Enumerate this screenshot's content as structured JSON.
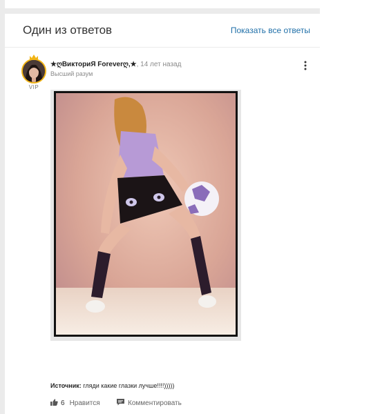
{
  "answer_card": {
    "title": "Один из ответов",
    "show_all_label": "Показать все ответы"
  },
  "author": {
    "name": "★ღВикториЯ Foreverღ,★",
    "time": "14 лет назад",
    "rank": "Высший разум",
    "badge": "VIP",
    "badge_color": "#f1b416"
  },
  "answer": {
    "source_label": "Источник:",
    "source_text": "гляди какие глазки лучше!!!!)))))"
  },
  "actions": {
    "likes_count": "6",
    "like_label": "Нравится",
    "comment_label": "Комментировать"
  },
  "icons": [
    "crown-icon",
    "more-vertical-icon",
    "thumbs-up-icon",
    "comment-icon"
  ]
}
